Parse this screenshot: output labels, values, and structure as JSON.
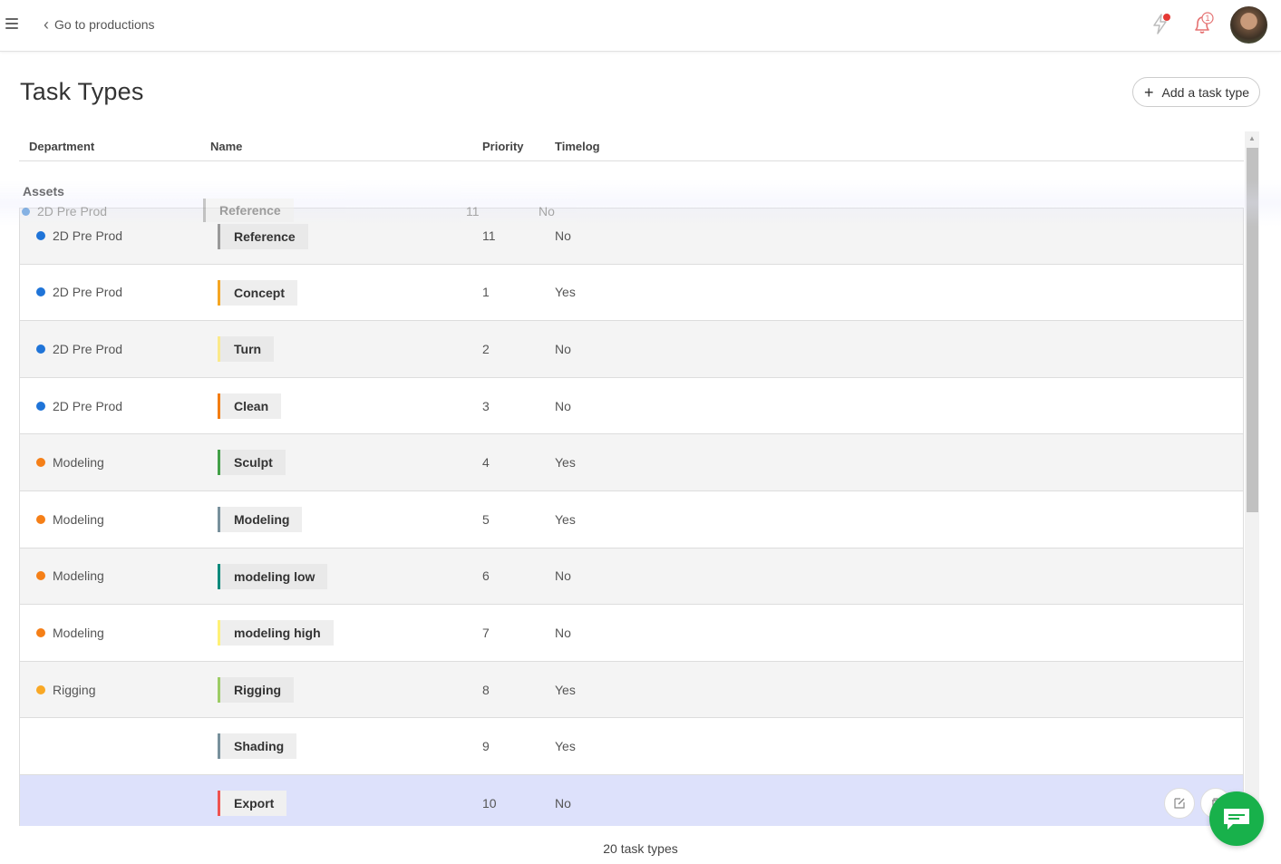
{
  "topbar": {
    "back_label": "Go to productions",
    "notification_count": "1"
  },
  "header": {
    "title": "Task Types",
    "add_label": "Add a task type"
  },
  "table": {
    "columns": {
      "department": "Department",
      "name": "Name",
      "priority": "Priority",
      "timelog": "Timelog"
    },
    "group": "Assets",
    "dragging": {
      "department": "2D Pre Prod",
      "dept_color": "#2b7bd6",
      "name": "Reference",
      "name_color": "#999999",
      "priority": "11",
      "timelog": "No"
    },
    "rows": [
      {
        "department": "2D Pre Prod",
        "dept_color": "#1f74d8",
        "name": "Reference",
        "name_color": "#999999",
        "priority": "11",
        "timelog": "No"
      },
      {
        "department": "2D Pre Prod",
        "dept_color": "#1f74d8",
        "name": "Concept",
        "name_color": "#f5a623",
        "priority": "1",
        "timelog": "Yes"
      },
      {
        "department": "2D Pre Prod",
        "dept_color": "#1f74d8",
        "name": "Turn",
        "name_color": "#fbe98a",
        "priority": "2",
        "timelog": "No"
      },
      {
        "department": "2D Pre Prod",
        "dept_color": "#1f74d8",
        "name": "Clean",
        "name_color": "#f37d12",
        "priority": "3",
        "timelog": "No"
      },
      {
        "department": "Modeling",
        "dept_color": "#f57f17",
        "name": "Sculpt",
        "name_color": "#43a047",
        "priority": "4",
        "timelog": "Yes"
      },
      {
        "department": "Modeling",
        "dept_color": "#f57f17",
        "name": "Modeling",
        "name_color": "#78909c",
        "priority": "5",
        "timelog": "Yes"
      },
      {
        "department": "Modeling",
        "dept_color": "#f57f17",
        "name": "modeling low",
        "name_color": "#00897b",
        "priority": "6",
        "timelog": "No"
      },
      {
        "department": "Modeling",
        "dept_color": "#f57f17",
        "name": "modeling high",
        "name_color": "#fff176",
        "priority": "7",
        "timelog": "No"
      },
      {
        "department": "Rigging",
        "dept_color": "#f9a825",
        "name": "Rigging",
        "name_color": "#9ccc65",
        "priority": "8",
        "timelog": "Yes"
      },
      {
        "department": "",
        "dept_color": "",
        "name": "Shading",
        "name_color": "#78909c",
        "priority": "9",
        "timelog": "Yes"
      },
      {
        "department": "",
        "dept_color": "",
        "name": "Export",
        "name_color": "#ef5350",
        "priority": "10",
        "timelog": "No"
      }
    ]
  },
  "footer": {
    "count_text": "20 task types"
  }
}
